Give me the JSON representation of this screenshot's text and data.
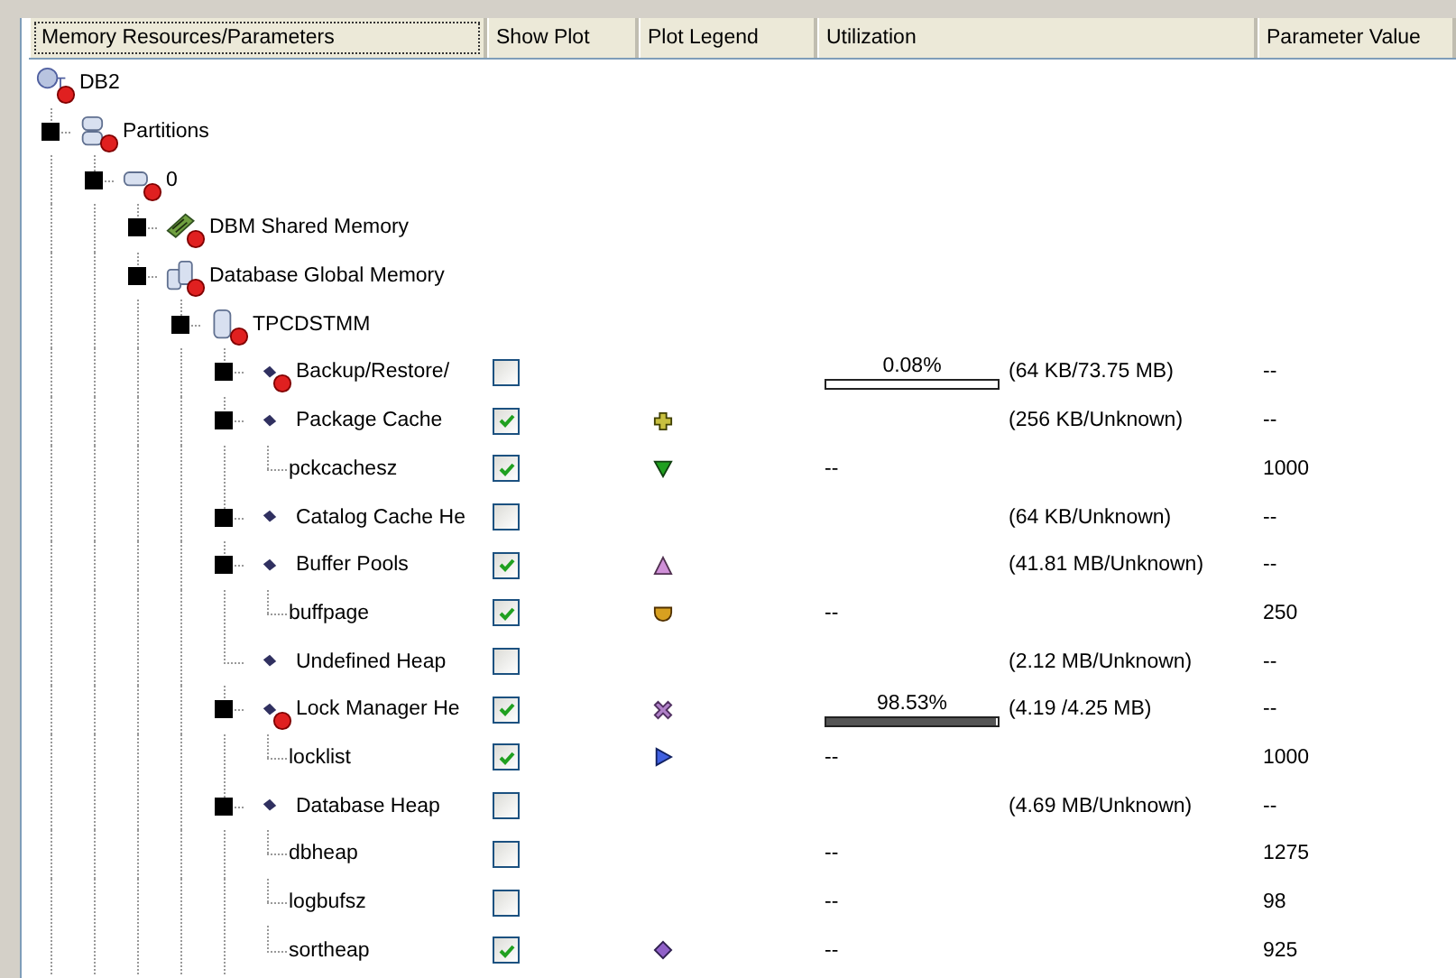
{
  "columns": [
    "Memory Resources/Parameters",
    "Show Plot",
    "Plot Legend",
    "Utilization",
    "Parameter Value"
  ],
  "tree": [
    {
      "label": "DB2",
      "kind": "instance",
      "alert": true,
      "expandable": false,
      "children": [
        {
          "label": "Partitions",
          "kind": "partitions",
          "alert": true,
          "expandable": true,
          "children": [
            {
              "label": "0",
              "kind": "partition",
              "alert": true,
              "expandable": true,
              "children": [
                {
                  "label": "DBM Shared Memory",
                  "kind": "memory-module",
                  "alert": true,
                  "expandable": true
                },
                {
                  "label": "Database Global Memory",
                  "kind": "db-memory",
                  "alert": true,
                  "expandable": true,
                  "children": [
                    {
                      "label": "TPCDSTMM",
                      "kind": "database",
                      "alert": true,
                      "expandable": true,
                      "children": [
                        {
                          "label": "Backup/Restore/",
                          "kind": "heap",
                          "alert": true,
                          "expandable": true,
                          "show_plot": {
                            "checked": false
                          },
                          "utilization": {
                            "level": 0.0008,
                            "label": "0.08%"
                          },
                          "usage": "(64 KB/73.75 MB)",
                          "value": "--"
                        },
                        {
                          "label": "Package Cache",
                          "kind": "heap",
                          "alert": false,
                          "expandable": true,
                          "show_plot": {
                            "checked": true
                          },
                          "legend": {
                            "kind": "plus",
                            "color": "#c8c040"
                          },
                          "usage": "(256 KB/Unknown)",
                          "value": "--",
                          "children": [
                            {
                              "label": "pckcachesz",
                              "kind": "parameter",
                              "alert": false,
                              "expandable": false,
                              "show_plot": {
                                "checked": true
                              },
                              "legend": {
                                "kind": "triangle-down",
                                "color": "#20a020"
                              },
                              "utilization": {
                                "text": "--"
                              },
                              "value": "1000"
                            }
                          ]
                        },
                        {
                          "label": "Catalog Cache He",
                          "kind": "heap",
                          "alert": false,
                          "expandable": true,
                          "show_plot": {
                            "checked": false
                          },
                          "usage": "(64 KB/Unknown)",
                          "value": "--"
                        },
                        {
                          "label": "Buffer Pools",
                          "kind": "heap",
                          "alert": false,
                          "expandable": true,
                          "show_plot": {
                            "checked": true
                          },
                          "legend": {
                            "kind": "triangle-up",
                            "color": "#d090d8"
                          },
                          "usage": "(41.81 MB/Unknown)",
                          "value": "--",
                          "children": [
                            {
                              "label": "buffpage",
                              "kind": "parameter",
                              "alert": false,
                              "expandable": false,
                              "show_plot": {
                                "checked": true
                              },
                              "legend": {
                                "kind": "bowl",
                                "color": "#d8a020"
                              },
                              "utilization": {
                                "text": "--"
                              },
                              "value": "250"
                            }
                          ]
                        },
                        {
                          "label": "Undefined Heap",
                          "kind": "heap",
                          "alert": false,
                          "expandable": false,
                          "show_plot": {
                            "checked": false
                          },
                          "usage": "(2.12 MB/Unknown)",
                          "value": "--"
                        },
                        {
                          "label": "Lock Manager He",
                          "kind": "heap",
                          "alert": true,
                          "expandable": true,
                          "show_plot": {
                            "checked": true
                          },
                          "legend": {
                            "kind": "cross",
                            "color": "#b080c8"
                          },
                          "utilization": {
                            "level": 0.9853,
                            "label": "98.53%"
                          },
                          "usage": "(4.19 /4.25 MB)",
                          "value": "--",
                          "children": [
                            {
                              "label": "locklist",
                              "kind": "parameter",
                              "alert": false,
                              "expandable": false,
                              "show_plot": {
                                "checked": true
                              },
                              "legend": {
                                "kind": "triangle-right",
                                "color": "#4060e0"
                              },
                              "utilization": {
                                "text": "--"
                              },
                              "value": "1000"
                            }
                          ]
                        },
                        {
                          "label": "Database Heap",
                          "kind": "heap",
                          "alert": false,
                          "expandable": true,
                          "show_plot": {
                            "checked": false
                          },
                          "usage": "(4.69 MB/Unknown)",
                          "value": "--",
                          "children": [
                            {
                              "label": "dbheap",
                              "kind": "parameter",
                              "alert": false,
                              "expandable": false,
                              "show_plot": {
                                "checked": false
                              },
                              "utilization": {
                                "text": "--"
                              },
                              "value": "1275"
                            },
                            {
                              "label": "logbufsz",
                              "kind": "parameter",
                              "alert": false,
                              "expandable": false,
                              "show_plot": {
                                "checked": false
                              },
                              "utilization": {
                                "text": "--"
                              },
                              "value": "98"
                            },
                            {
                              "label": "sortheap",
                              "kind": "parameter",
                              "alert": false,
                              "expandable": false,
                              "show_plot": {
                                "checked": true
                              },
                              "legend": {
                                "kind": "diamond",
                                "color": "#9060c8"
                              },
                              "utilization": {
                                "text": "--"
                              },
                              "value": "925"
                            }
                          ]
                        }
                      ]
                    }
                  ]
                }
              ]
            }
          ]
        }
      ]
    }
  ]
}
